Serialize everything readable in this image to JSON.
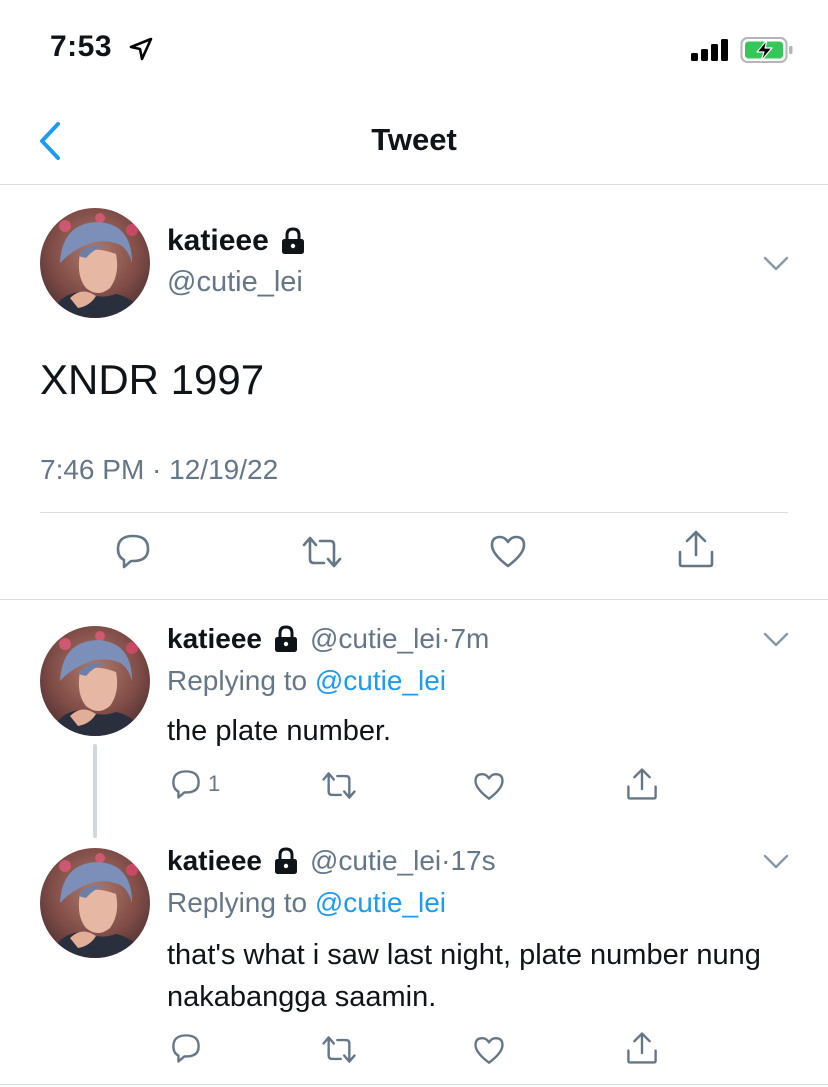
{
  "status_bar": {
    "time": "7:53",
    "location_icon": "location-arrow-icon",
    "signal_icon": "cellular-signal-icon",
    "battery_icon": "battery-charging-icon",
    "battery_color": "#34c759"
  },
  "nav": {
    "back_icon": "chevron-left-icon",
    "title": "Tweet",
    "accent": "#1d9bf0"
  },
  "main_tweet": {
    "name": "katieee",
    "handle": "@cutie_lei",
    "text": "XNDR 1997",
    "timestamp": "7:46 PM · 12/19/22",
    "protected_icon": "lock-icon",
    "actions": [
      "reply-icon",
      "retweet-icon",
      "like-icon",
      "share-icon"
    ]
  },
  "replies": [
    {
      "name": "katieee",
      "handle": "@cutie_lei",
      "separator": "·",
      "time": "7m",
      "replying_prefix": "Replying to",
      "replying_to": "@cutie_lei",
      "text": "the plate number.",
      "reply_count": "1"
    },
    {
      "name": "katieee",
      "handle": "@cutie_lei",
      "separator": "·",
      "time": "17s",
      "replying_prefix": "Replying to",
      "replying_to": "@cutie_lei",
      "text": "that's what i saw last night, plate number nung nakabangga saamin.",
      "reply_count": ""
    }
  ]
}
